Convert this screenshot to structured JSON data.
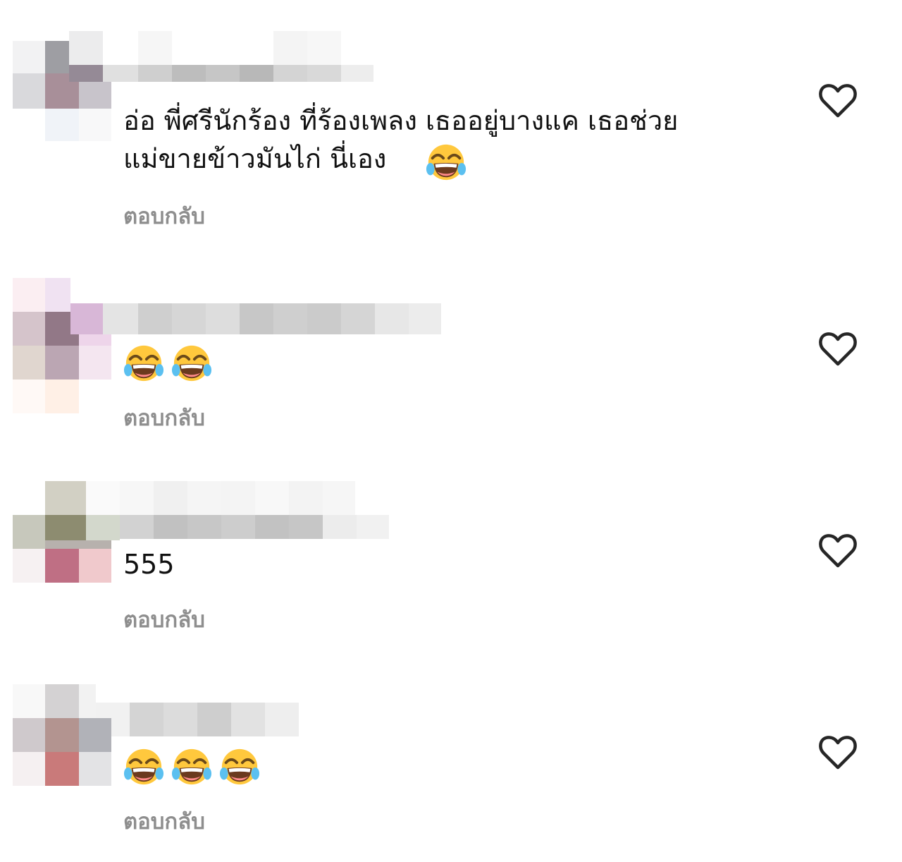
{
  "comments": [
    {
      "text": "อ่อ พี่ศรีนักร้อง ที่ร้องเพลง เธออยู่บางแค เธอช่วย\nแม่ขายข้าวมันไก่ นี่เอง",
      "trailing_emoji": "face-with-tears-of-joy",
      "reply_label": "ตอบกลับ",
      "username": "",
      "username_blurred": true,
      "avatar_blurred": true
    },
    {
      "text": "",
      "emoji": [
        "face-with-tears-of-joy",
        "face-with-tears-of-joy"
      ],
      "reply_label": "ตอบกลับ",
      "username": "",
      "username_blurred": true,
      "avatar_blurred": true
    },
    {
      "text": "555",
      "reply_label": "ตอบกลับ",
      "username": "",
      "username_blurred": true,
      "avatar_blurred": true
    },
    {
      "text": "",
      "emoji": [
        "face-with-tears-of-joy",
        "face-with-tears-of-joy",
        "face-with-tears-of-joy"
      ],
      "reply_label": "ตอบกลับ",
      "username": "",
      "username_blurred": true,
      "avatar_blurred": true
    }
  ],
  "colors": {
    "background": "#ffffff",
    "text": "#111111",
    "reply_text": "#8e8e8e",
    "heart_stroke": "#262626",
    "emoji_face": "#ffc83d",
    "emoji_tear": "#5bc0f0"
  }
}
